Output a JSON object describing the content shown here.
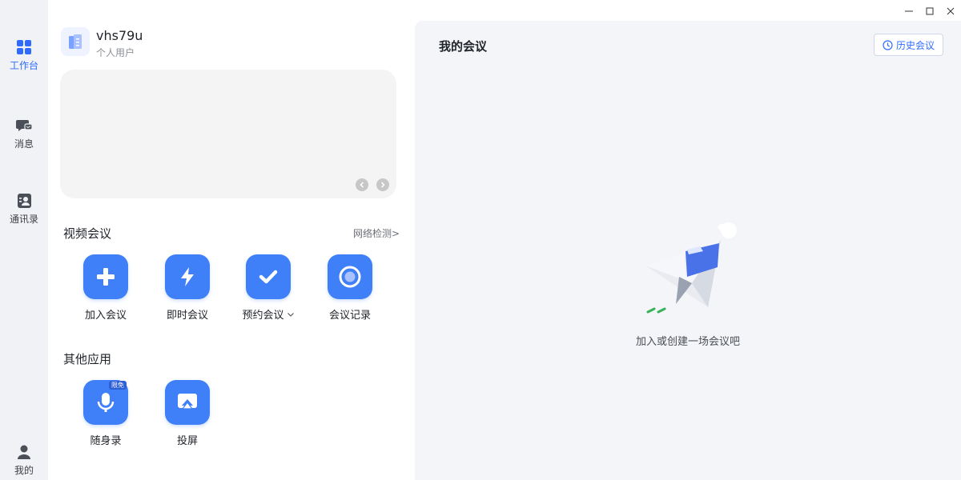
{
  "sidebar": {
    "items": [
      {
        "label": "工作台",
        "icon": "grid-icon",
        "active": true
      },
      {
        "label": "消息",
        "icon": "chat-icon",
        "active": false
      },
      {
        "label": "通讯录",
        "icon": "contacts-icon",
        "active": false
      },
      {
        "label": "我的",
        "icon": "user-icon",
        "active": false
      }
    ]
  },
  "window_controls": [
    "minimize-icon",
    "maximize-icon",
    "close-icon"
  ],
  "user": {
    "name": "vhs79u",
    "type": "个人用户"
  },
  "video_meeting": {
    "title": "视频会议",
    "network_check": "网络检测>",
    "apps": [
      {
        "label": "加入会议",
        "icon": "plus-icon"
      },
      {
        "label": "即时会议",
        "icon": "lightning-icon"
      },
      {
        "label": "预约会议",
        "icon": "check-icon",
        "has_dropdown": true
      },
      {
        "label": "会议记录",
        "icon": "record-icon"
      }
    ]
  },
  "other_apps": {
    "title": "其他应用",
    "apps": [
      {
        "label": "随身录",
        "icon": "microphone-icon",
        "badge": "限免"
      },
      {
        "label": "投屏",
        "icon": "screen-cast-icon"
      }
    ]
  },
  "my_meetings": {
    "title": "我的会议",
    "history_button": "历史会议",
    "empty_text": "加入或创建一场会议吧"
  },
  "colors": {
    "accent": "#3f7ff7",
    "link": "#2f6bff",
    "rail_bg": "#f1f2f6",
    "panel_bg": "#f4f5f8"
  }
}
